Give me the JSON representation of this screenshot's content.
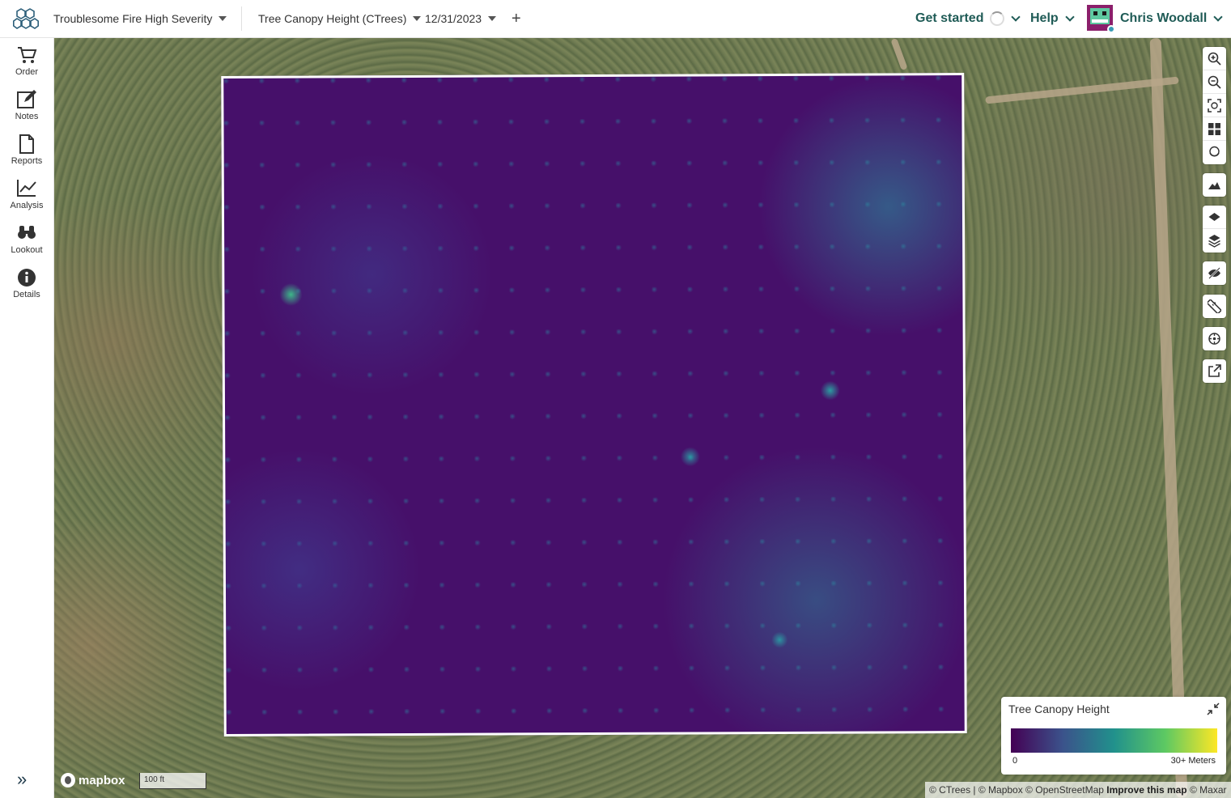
{
  "header": {
    "project": "Troublesome Fire High Severity",
    "layer": "Tree Canopy Height (CTrees)",
    "date": "12/31/2023",
    "add_label": "+",
    "get_started": "Get started",
    "help": "Help",
    "user_name": "Chris Woodall"
  },
  "sidebar": {
    "items": [
      {
        "label": "Order",
        "icon": "cart-icon"
      },
      {
        "label": "Notes",
        "icon": "edit-icon"
      },
      {
        "label": "Reports",
        "icon": "document-icon"
      },
      {
        "label": "Analysis",
        "icon": "line-chart-icon"
      },
      {
        "label": "Lookout",
        "icon": "binoculars-icon"
      },
      {
        "label": "Details",
        "icon": "info-icon"
      }
    ],
    "expand_label": "»"
  },
  "map_tools": [
    "zoom-in-icon",
    "zoom-out-icon",
    "fit-bounds-icon",
    "grid-icon",
    "basemap-icon",
    "terrain-icon",
    "layer-icon",
    "layers-stack-icon",
    "hide-icon",
    "ruler-icon",
    "crosshair-icon",
    "external-link-icon"
  ],
  "legend": {
    "title": "Tree Canopy Height",
    "min_label": "0",
    "max_label": "30+ Meters",
    "colors": [
      "#440154",
      "#3b528b",
      "#21918c",
      "#5ec962",
      "#fde725"
    ]
  },
  "map": {
    "brand": "mapbox",
    "scale_label": "100 ft",
    "attribution_prefix": "© CTrees | © Mapbox © OpenStreetMap ",
    "attribution_link": "Improve this map",
    "attribution_suffix": " © Maxar"
  },
  "colors": {
    "accent": "#1f5b56",
    "aoi_base": "#46106a"
  }
}
